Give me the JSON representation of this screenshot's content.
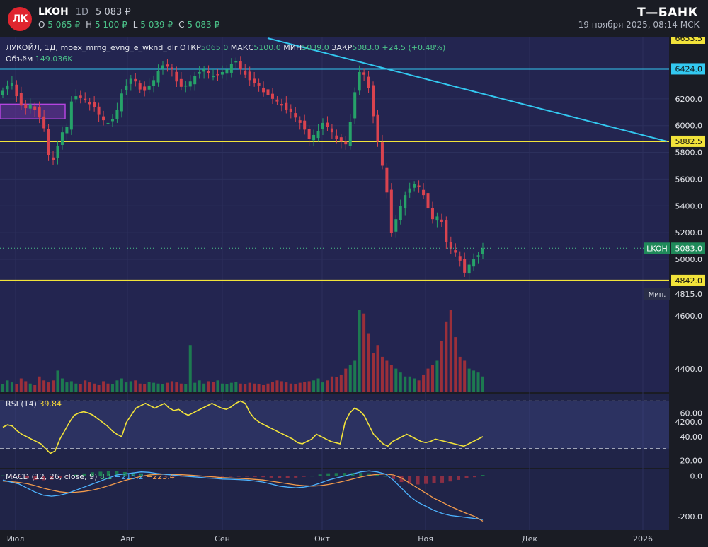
{
  "header": {
    "ticker": "LKOH",
    "timeframe": "1D",
    "price": "5 083 ₽",
    "ohlc": [
      {
        "label": "O",
        "value": "5 065 ₽"
      },
      {
        "label": "H",
        "value": "5 100 ₽"
      },
      {
        "label": "L",
        "value": "5 039 ₽"
      },
      {
        "label": "C",
        "value": "5 083 ₽"
      }
    ],
    "brand": "Т—БАНК",
    "datetime": "19 ноября 2025, 08:14 МСК",
    "logo": "lukoil-logo",
    "logo_text": "ЛК"
  },
  "legend": {
    "symbol_line": "ЛУКОЙЛ, 1Д, moex_mrng_evng_e_wknd_dlr",
    "open_label": "ОТКР",
    "open_value": "5065.0",
    "high_label": "МАКС",
    "high_value": "5100.0",
    "low_label": "МИН",
    "low_value": "5039.0",
    "close_label": "ЗАКР",
    "close_value": "5083.0",
    "change": "+24.5 (+0.48%)",
    "volume_label": "Объём",
    "volume_value": "149.036K",
    "rsi_label": "RSI (14)",
    "rsi_value": "39.84",
    "macd_label": "MACD (12, 26, close, 9)",
    "macd_hist": "8.1",
    "macd_line": "−215.2",
    "macd_signal": "−223.4"
  },
  "colors": {
    "background": "#232550",
    "up": "#26a269",
    "down": "#d9434f",
    "level_yellow": "#f2e33a",
    "trendline": "#33c8f0",
    "rsi": "#f2e33a",
    "macd": "#4db3ff",
    "signal": "#f39b4c",
    "zone": "#b545e0"
  },
  "chart_data": [
    {
      "type": "candlestick",
      "title": "ЛУКОЙЛ, 1Д",
      "x_ticks": [
        "Июл",
        "Авг",
        "Сен",
        "Окт",
        "Ноя",
        "Дек",
        "2026"
      ],
      "y_ticks": [
        6200,
        6000,
        5800,
        5600,
        5400,
        5200,
        5000
      ],
      "ylim": [
        4815,
        6653.5
      ],
      "price_labels": [
        {
          "value": 6653.5,
          "text": "6653.5"
        },
        {
          "value": 6424.0,
          "text": "6424.0"
        },
        {
          "value": 5882.5,
          "text": "5882.5"
        },
        {
          "value": 4842.0,
          "text": "4842.0"
        }
      ],
      "current_price": {
        "label": "LKOH",
        "value": 5083.0,
        "text": "5083.0"
      },
      "min_marker": {
        "label": "Мин.",
        "value": 4815.0,
        "text": "4815.0"
      },
      "horizontal_levels": [
        6424.0,
        5882.5,
        4842.0
      ],
      "trendline": {
        "from": {
          "date": "2025-09-14",
          "price": 6653.5
        },
        "to": {
          "date": "2025-12-27",
          "price": 5882.5
        }
      },
      "zone": {
        "from_date": "2025-06-26",
        "to_date": "2025-07-07",
        "price_low": 6050,
        "price_high": 6160
      },
      "close_series": [
        6260,
        6300,
        6320,
        6220,
        6150,
        6130,
        6160,
        6120,
        6060,
        5980,
        5780,
        5740,
        5850,
        5950,
        5990,
        6180,
        6220,
        6210,
        6200,
        6160,
        6140,
        6080,
        6040,
        6020,
        6050,
        6120,
        6240,
        6300,
        6350,
        6330,
        6270,
        6260,
        6300,
        6340,
        6410,
        6450,
        6440,
        6420,
        6330,
        6290,
        6300,
        6330,
        6370,
        6400,
        6420,
        6390,
        6370,
        6380,
        6400,
        6420,
        6460,
        6480,
        6420,
        6380,
        6340,
        6320,
        6300,
        6250,
        6230,
        6200,
        6180,
        6150,
        6120,
        6100,
        6060,
        6020,
        5970,
        5900,
        5930,
        5960,
        6020,
        5990,
        5950,
        5900,
        5880,
        5860,
        6030,
        6250,
        6400,
        6380,
        6280,
        6070,
        5880,
        5700,
        5500,
        5200,
        5300,
        5400,
        5480,
        5530,
        5560,
        5540,
        5480,
        5380,
        5300,
        5320,
        5280,
        5130,
        5080,
        5050,
        4990,
        4900,
        4960,
        5000,
        5030,
        5083
      ],
      "volume_ticks": [
        4600,
        4400,
        4200
      ],
      "volume_series": [
        20,
        30,
        25,
        20,
        35,
        28,
        22,
        18,
        40,
        30,
        25,
        30,
        55,
        35,
        25,
        28,
        22,
        20,
        30,
        25,
        22,
        18,
        28,
        22,
        20,
        30,
        35,
        25,
        28,
        30,
        22,
        20,
        26,
        24,
        22,
        20,
        24,
        28,
        25,
        22,
        20,
        120,
        24,
        30,
        22,
        28,
        26,
        30,
        22,
        20,
        24,
        26,
        22,
        20,
        24,
        22,
        20,
        18,
        22,
        26,
        30,
        28,
        25,
        22,
        20,
        24,
        26,
        28,
        30,
        35,
        25,
        30,
        40,
        38,
        45,
        60,
        70,
        80,
        210,
        200,
        150,
        100,
        120,
        90,
        80,
        70,
        60,
        50,
        40,
        40,
        35,
        30,
        45,
        60,
        70,
        80,
        130,
        180,
        210,
        140,
        90,
        80,
        60,
        55,
        50,
        40
      ],
      "rsi": {
        "ticks": [
          60.0,
          40.0,
          20.0
        ],
        "upper": 70,
        "lower": 30,
        "ylim": [
          15,
          75
        ],
        "values": [
          48,
          50,
          49,
          45,
          42,
          40,
          38,
          36,
          34,
          30,
          26,
          28,
          38,
          45,
          52,
          58,
          60,
          61,
          60,
          58,
          55,
          52,
          49,
          45,
          42,
          40,
          52,
          58,
          64,
          66,
          68,
          66,
          64,
          66,
          68,
          64,
          62,
          63,
          60,
          58,
          60,
          62,
          64,
          66,
          68,
          66,
          64,
          63,
          65,
          68,
          70,
          68,
          60,
          55,
          52,
          50,
          48,
          46,
          44,
          42,
          40,
          38,
          35,
          34,
          36,
          38,
          42,
          40,
          38,
          36,
          35,
          34,
          52,
          60,
          64,
          62,
          58,
          50,
          42,
          38,
          34,
          32,
          36,
          38,
          40,
          42,
          40,
          38,
          36,
          35,
          36,
          38,
          37,
          36,
          35,
          34,
          33,
          32,
          34,
          36,
          38,
          40
        ]
      },
      "macd": {
        "ticks": [
          0.0,
          -200.0
        ],
        "ylim": [
          -260,
          40
        ],
        "macd_values": [
          -20,
          -30,
          -40,
          -60,
          -80,
          -95,
          -100,
          -95,
          -85,
          -70,
          -55,
          -40,
          -25,
          -10,
          5,
          10,
          15,
          20,
          18,
          12,
          8,
          4,
          0,
          -3,
          -6,
          -10,
          -12,
          -15,
          -16,
          -18,
          -20,
          -25,
          -30,
          -40,
          -50,
          -55,
          -58,
          -55,
          -48,
          -35,
          -20,
          -10,
          0,
          10,
          20,
          25,
          20,
          10,
          -20,
          -60,
          -100,
          -130,
          -150,
          -170,
          -185,
          -195,
          -200,
          -205,
          -210,
          -215
        ],
        "signal_values": [
          -25,
          -28,
          -32,
          -38,
          -48,
          -60,
          -70,
          -78,
          -82,
          -80,
          -76,
          -70,
          -60,
          -48,
          -35,
          -22,
          -12,
          -2,
          5,
          8,
          9,
          8,
          6,
          4,
          1,
          -2,
          -5,
          -8,
          -10,
          -12,
          -14,
          -17,
          -20,
          -26,
          -32,
          -38,
          -44,
          -48,
          -50,
          -48,
          -42,
          -34,
          -25,
          -15,
          -5,
          3,
          8,
          10,
          5,
          -10,
          -35,
          -60,
          -85,
          -110,
          -130,
          -150,
          -168,
          -185,
          -200,
          -223
        ]
      }
    }
  ]
}
